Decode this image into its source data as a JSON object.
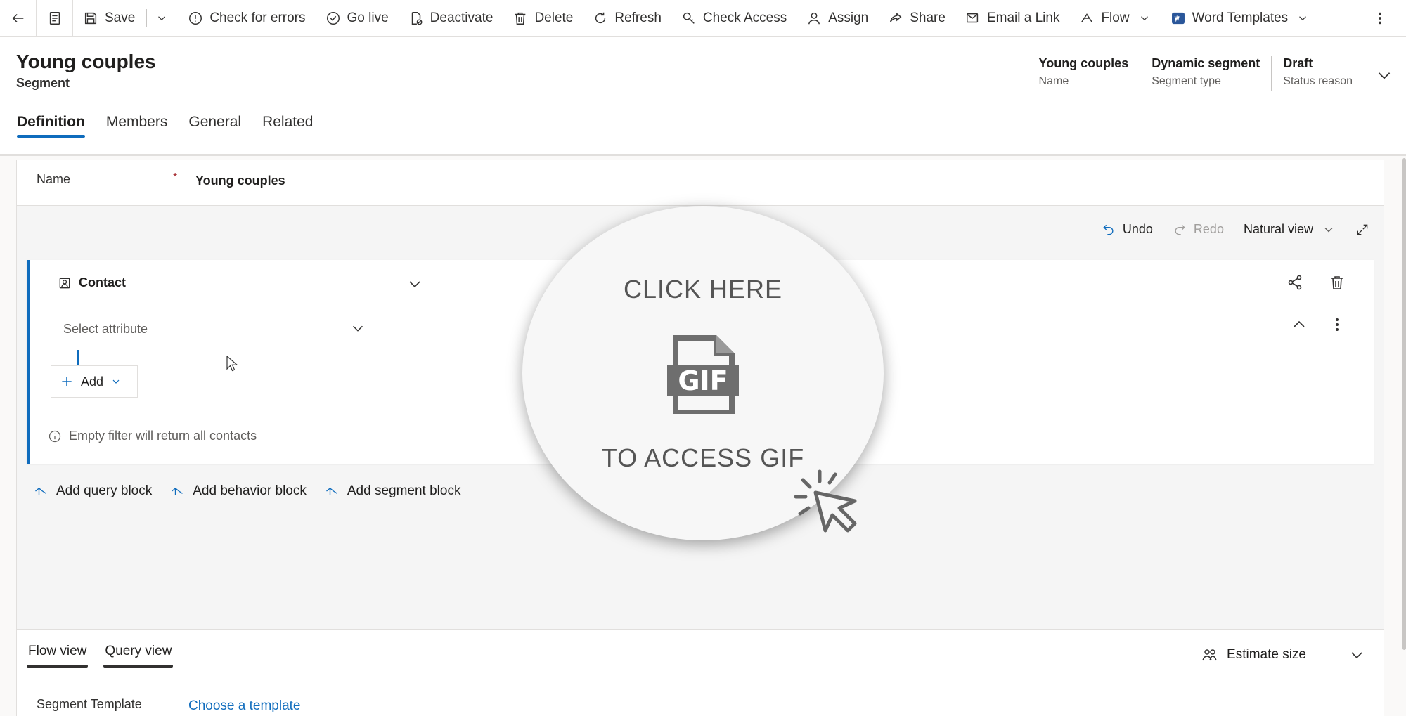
{
  "commandbar": {
    "save": "Save",
    "check_errors": "Check for errors",
    "go_live": "Go live",
    "deactivate": "Deactivate",
    "delete": "Delete",
    "refresh": "Refresh",
    "check_access": "Check Access",
    "assign": "Assign",
    "share": "Share",
    "email_link": "Email a Link",
    "flow": "Flow",
    "word_templates": "Word Templates"
  },
  "header": {
    "title": "Young couples",
    "subtitle": "Segment",
    "fields": [
      {
        "value": "Young couples",
        "label": "Name"
      },
      {
        "value": "Dynamic segment",
        "label": "Segment type"
      },
      {
        "value": "Draft",
        "label": "Status reason"
      }
    ],
    "tabs": [
      "Definition",
      "Members",
      "General",
      "Related"
    ]
  },
  "form": {
    "name_label": "Name",
    "required_mark": "*",
    "name_value": "Young couples",
    "undo": "Undo",
    "redo": "Redo",
    "view_mode": "Natural view",
    "entity": "Contact",
    "attribute_placeholder": "Select attribute",
    "add": "Add",
    "info": "Empty filter will return all contacts",
    "block_links": [
      "Add query block",
      "Add behavior block",
      "Add segment block"
    ]
  },
  "lower": {
    "tabs": [
      "Flow view",
      "Query view"
    ],
    "estimate": "Estimate size",
    "template_label": "Segment Template",
    "template_link": "Choose a template"
  },
  "overlay": {
    "top": "CLICK HERE",
    "gif": "GIF",
    "bottom": "TO ACCESS GIF"
  },
  "colors": {
    "accent": "#0f6cbd",
    "required": "#a4262c"
  }
}
